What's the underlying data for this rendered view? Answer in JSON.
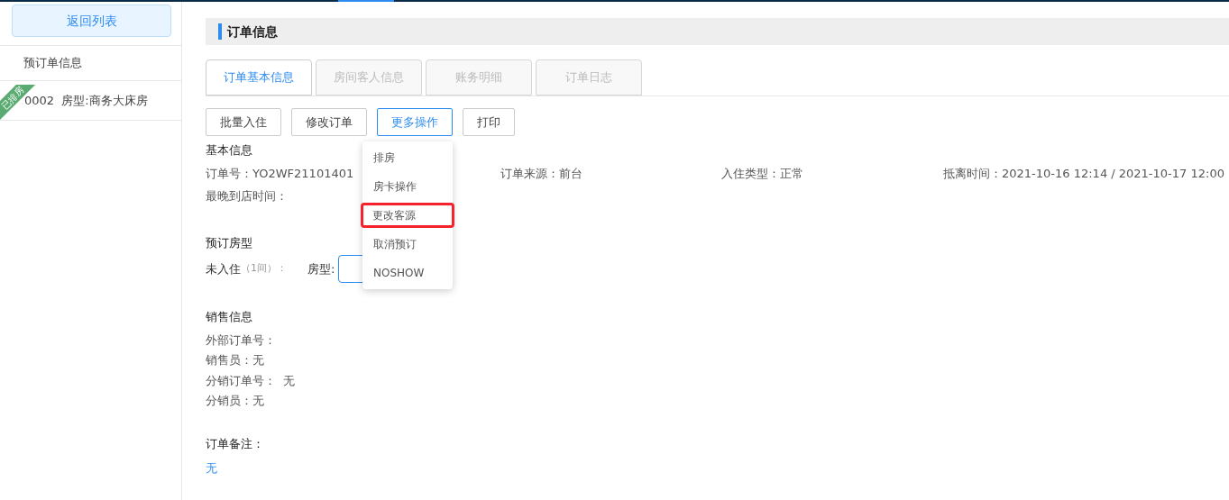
{
  "sidebar": {
    "back_button": "返回列表",
    "section_title": "预订单信息",
    "rooms": [
      {
        "tag": "已排房",
        "label": "0002  房型:商务大床房",
        "selected": false
      }
    ]
  },
  "header": {
    "title": "订单信息"
  },
  "tabs": [
    {
      "label": "订单基本信息",
      "selected": true
    },
    {
      "label": "房间客人信息",
      "selected": false
    },
    {
      "label": "账务明细",
      "selected": false
    },
    {
      "label": "订单日志",
      "selected": false
    }
  ],
  "actions": [
    {
      "label": "批量入住",
      "selected": false
    },
    {
      "label": "修改订单",
      "selected": false
    },
    {
      "label": "更多操作",
      "selected": true
    },
    {
      "label": "打印",
      "selected": false
    }
  ],
  "dropdown": [
    {
      "label": "排房",
      "highlighted": false
    },
    {
      "label": "房卡操作",
      "highlighted": false
    },
    {
      "label": "更改客源",
      "highlighted": true
    },
    {
      "label": "取消预订",
      "highlighted": false
    },
    {
      "label": "NOSHOW",
      "highlighted": false
    }
  ],
  "basic": {
    "title": "基本信息",
    "fields": [
      "订单号：YO2WF21101401",
      "订单来源：前台",
      "入住类型：正常",
      "抵离时间：2021-10-16 12:14 / 2021-10-17 12:00"
    ],
    "arrival": "最晚到店时间："
  },
  "room_type": {
    "title": "预订房型",
    "status": "未入住",
    "count": "（1间）：",
    "type_label": "房型:"
  },
  "sales": {
    "title": "销售信息",
    "fields": [
      "外部订单号：",
      "销售员：无",
      "分销订单号：  无",
      "分销员：无"
    ]
  },
  "remark": {
    "title": "订单备注：",
    "value": "无"
  }
}
